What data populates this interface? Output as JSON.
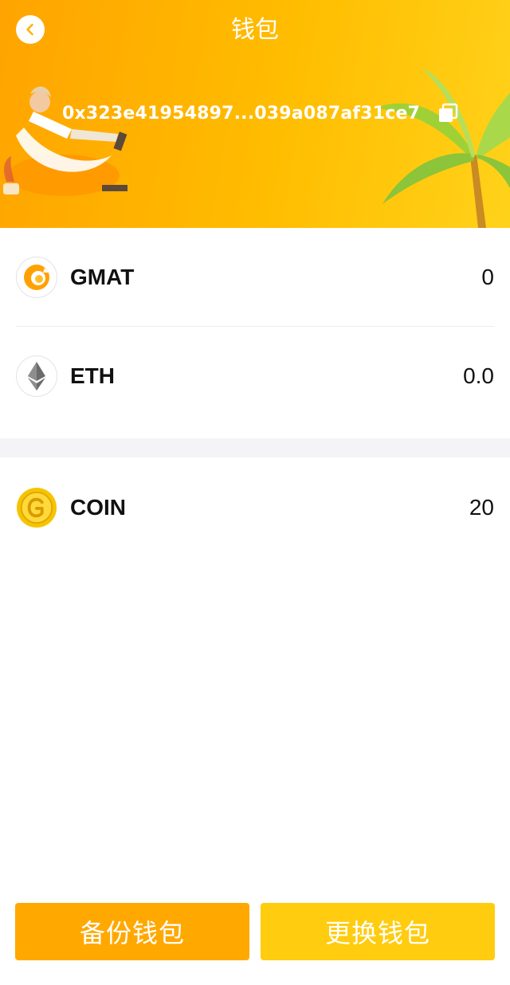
{
  "header": {
    "title": "钱包",
    "address": "0x323e41954897...039a087af31ce7",
    "back_icon": "chevron-left-icon",
    "copy_icon": "copy-icon",
    "colors": {
      "gradient_start": "#ffa400",
      "gradient_end": "#ffd21a"
    }
  },
  "tokens": [
    {
      "name": "GMAT",
      "value": "0",
      "icon": "gmat-token-icon"
    },
    {
      "name": "ETH",
      "value": "0.0",
      "icon": "ethereum-icon"
    }
  ],
  "points": [
    {
      "name": "COIN",
      "value": "20",
      "icon": "gold-coin-icon"
    }
  ],
  "footer": {
    "backup_label": "备份钱包",
    "change_label": "更换钱包",
    "colors": {
      "backup": "#ffa800",
      "change": "#ffcc0f"
    }
  }
}
